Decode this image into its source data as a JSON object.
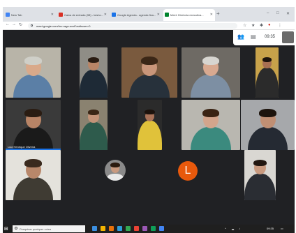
{
  "browser": {
    "tabs": [
      {
        "title": "New Tab",
        "favicon_color": "#4285f4"
      },
      {
        "title": "Caixa de entrada (98) - luisho...",
        "favicon_color": "#d93025"
      },
      {
        "title": "Google Agenda - agenda fixa...",
        "favicon_color": "#1a73e8"
      },
      {
        "title": "Meet: Diretoria executiva...",
        "favicon_color": "#00832d"
      }
    ],
    "active_tab_index": 3,
    "new_tab_icon": "plus-icon",
    "url": "meet.google.com/hrv-ragn-wvd?authuser=0",
    "window_controls": [
      "–",
      "□",
      "✕"
    ]
  },
  "meet": {
    "clock": "09:35",
    "participants": [
      {
        "name": "",
        "skin": "#d9a98a",
        "hair": "#cfcfc8",
        "shirt": "#5b7fa6",
        "bg": "#b8b4a8"
      },
      {
        "name": "",
        "skin": "#b98566",
        "hair": "#2a1c12",
        "shirt": "#1e2a36",
        "bg": "#8f8d86"
      },
      {
        "name": "",
        "skin": "#c9967a",
        "hair": "#3b2717",
        "shirt": "#27313b",
        "bg": "#7a5a3e"
      },
      {
        "name": "",
        "skin": "#d8a990",
        "hair": "#d7d5d0",
        "shirt": "#7d8fa3",
        "bg": "#6e6a64"
      },
      {
        "name": "",
        "skin": "#a87052",
        "hair": "#1d130c",
        "shirt": "#2b2b2b",
        "bg": "#c8a24a"
      },
      {
        "name": "Luiz Henrique Oliveira",
        "skin": "#b88466",
        "hair": "#2a1c12",
        "shirt": "#1a1a1a",
        "bg": "#3a3a3a"
      },
      {
        "name": "",
        "skin": "#c29378",
        "hair": "#3a2616",
        "shirt": "#2e5b4c",
        "bg": "#8a8270"
      },
      {
        "name": "",
        "skin": "#a97258",
        "hair": "#1c120c",
        "shirt": "#e0c23a",
        "bg": "#2b2b2b"
      },
      {
        "name": "",
        "skin": "#d3a58c",
        "hair": "#3a2313",
        "shirt": "#3b8a7e",
        "bg": "#b9b7b0"
      },
      {
        "name": "",
        "skin": "#c08f74",
        "hair": "#1d140d",
        "shirt": "#252a33",
        "bg": "#a6a8ab"
      },
      {
        "name": "",
        "skin": "#b8876a",
        "hair": "#3a2a1e",
        "shirt": "#3f3b33",
        "bg": "#e4e2dc"
      },
      {
        "name": "",
        "skin": "#c89a80",
        "hair": "#2a1a0f",
        "shirt": "#e9e9e9",
        "bg": "#8a8a8a"
      },
      {
        "name": "",
        "initial": "L",
        "color": "#e8590c"
      },
      {
        "name": "",
        "skin": "#c99a7f",
        "hair": "#221710",
        "shirt": "#2a2d33",
        "bg": "#d9d7d2"
      }
    ]
  },
  "taskbar": {
    "search_placeholder": "Pesquisar qualquer coisa",
    "apps": [
      "#3c8fe0",
      "#f4b400",
      "#e8710a",
      "#2d9cdb",
      "#34a853",
      "#ea4335",
      "#9b59b6",
      "#0f9d58",
      "#4285f4"
    ],
    "tray_time": "09:35",
    "tray_date": "09:35"
  },
  "colors": {
    "meet_bg": "#202124",
    "tab_strip": "#dee1e6",
    "speaking": "#1a73e8",
    "taskbar": "#1f1f1f"
  }
}
